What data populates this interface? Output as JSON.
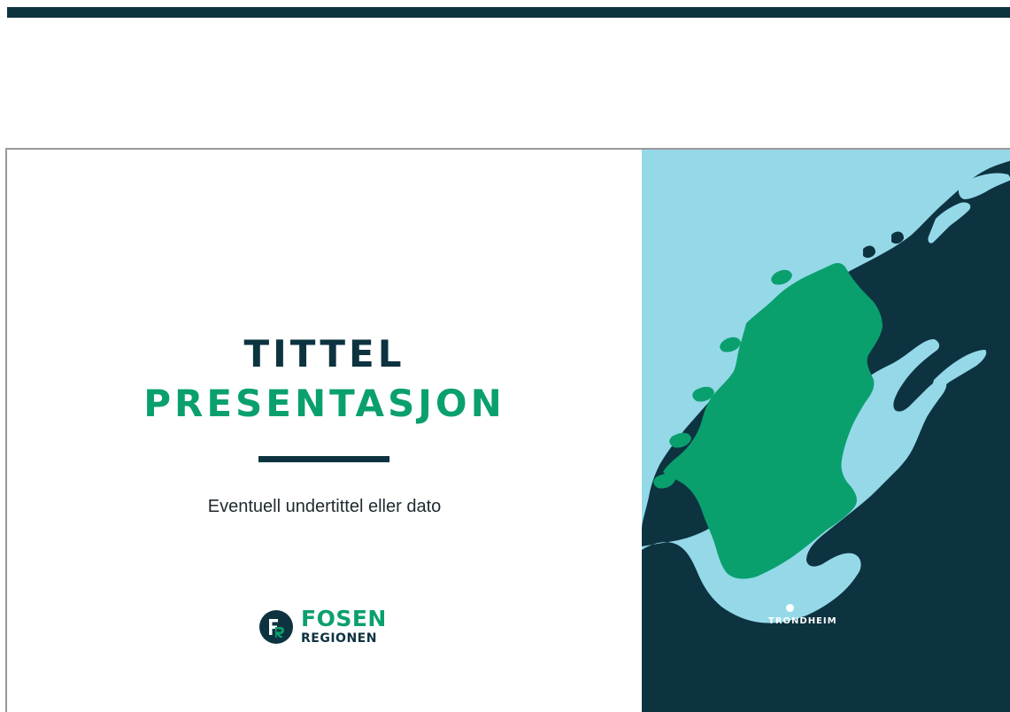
{
  "slide": {
    "title_line1": "TITTEL",
    "title_line2": "PRESENTASJON",
    "subtitle": "Eventuell undertittel eller dato"
  },
  "logo": {
    "mark_icon": "fosen-regionen-fr-mark-icon",
    "word_line1": "FOSEN",
    "word_line2": "REGIONEN"
  },
  "map": {
    "city_label": "TRONDHEIM",
    "colors": {
      "sea": "#95d9e9",
      "land": "#0d3340",
      "region": "#0aa06e"
    }
  },
  "colors": {
    "dark": "#0d3340",
    "accent": "#0aa06e"
  }
}
